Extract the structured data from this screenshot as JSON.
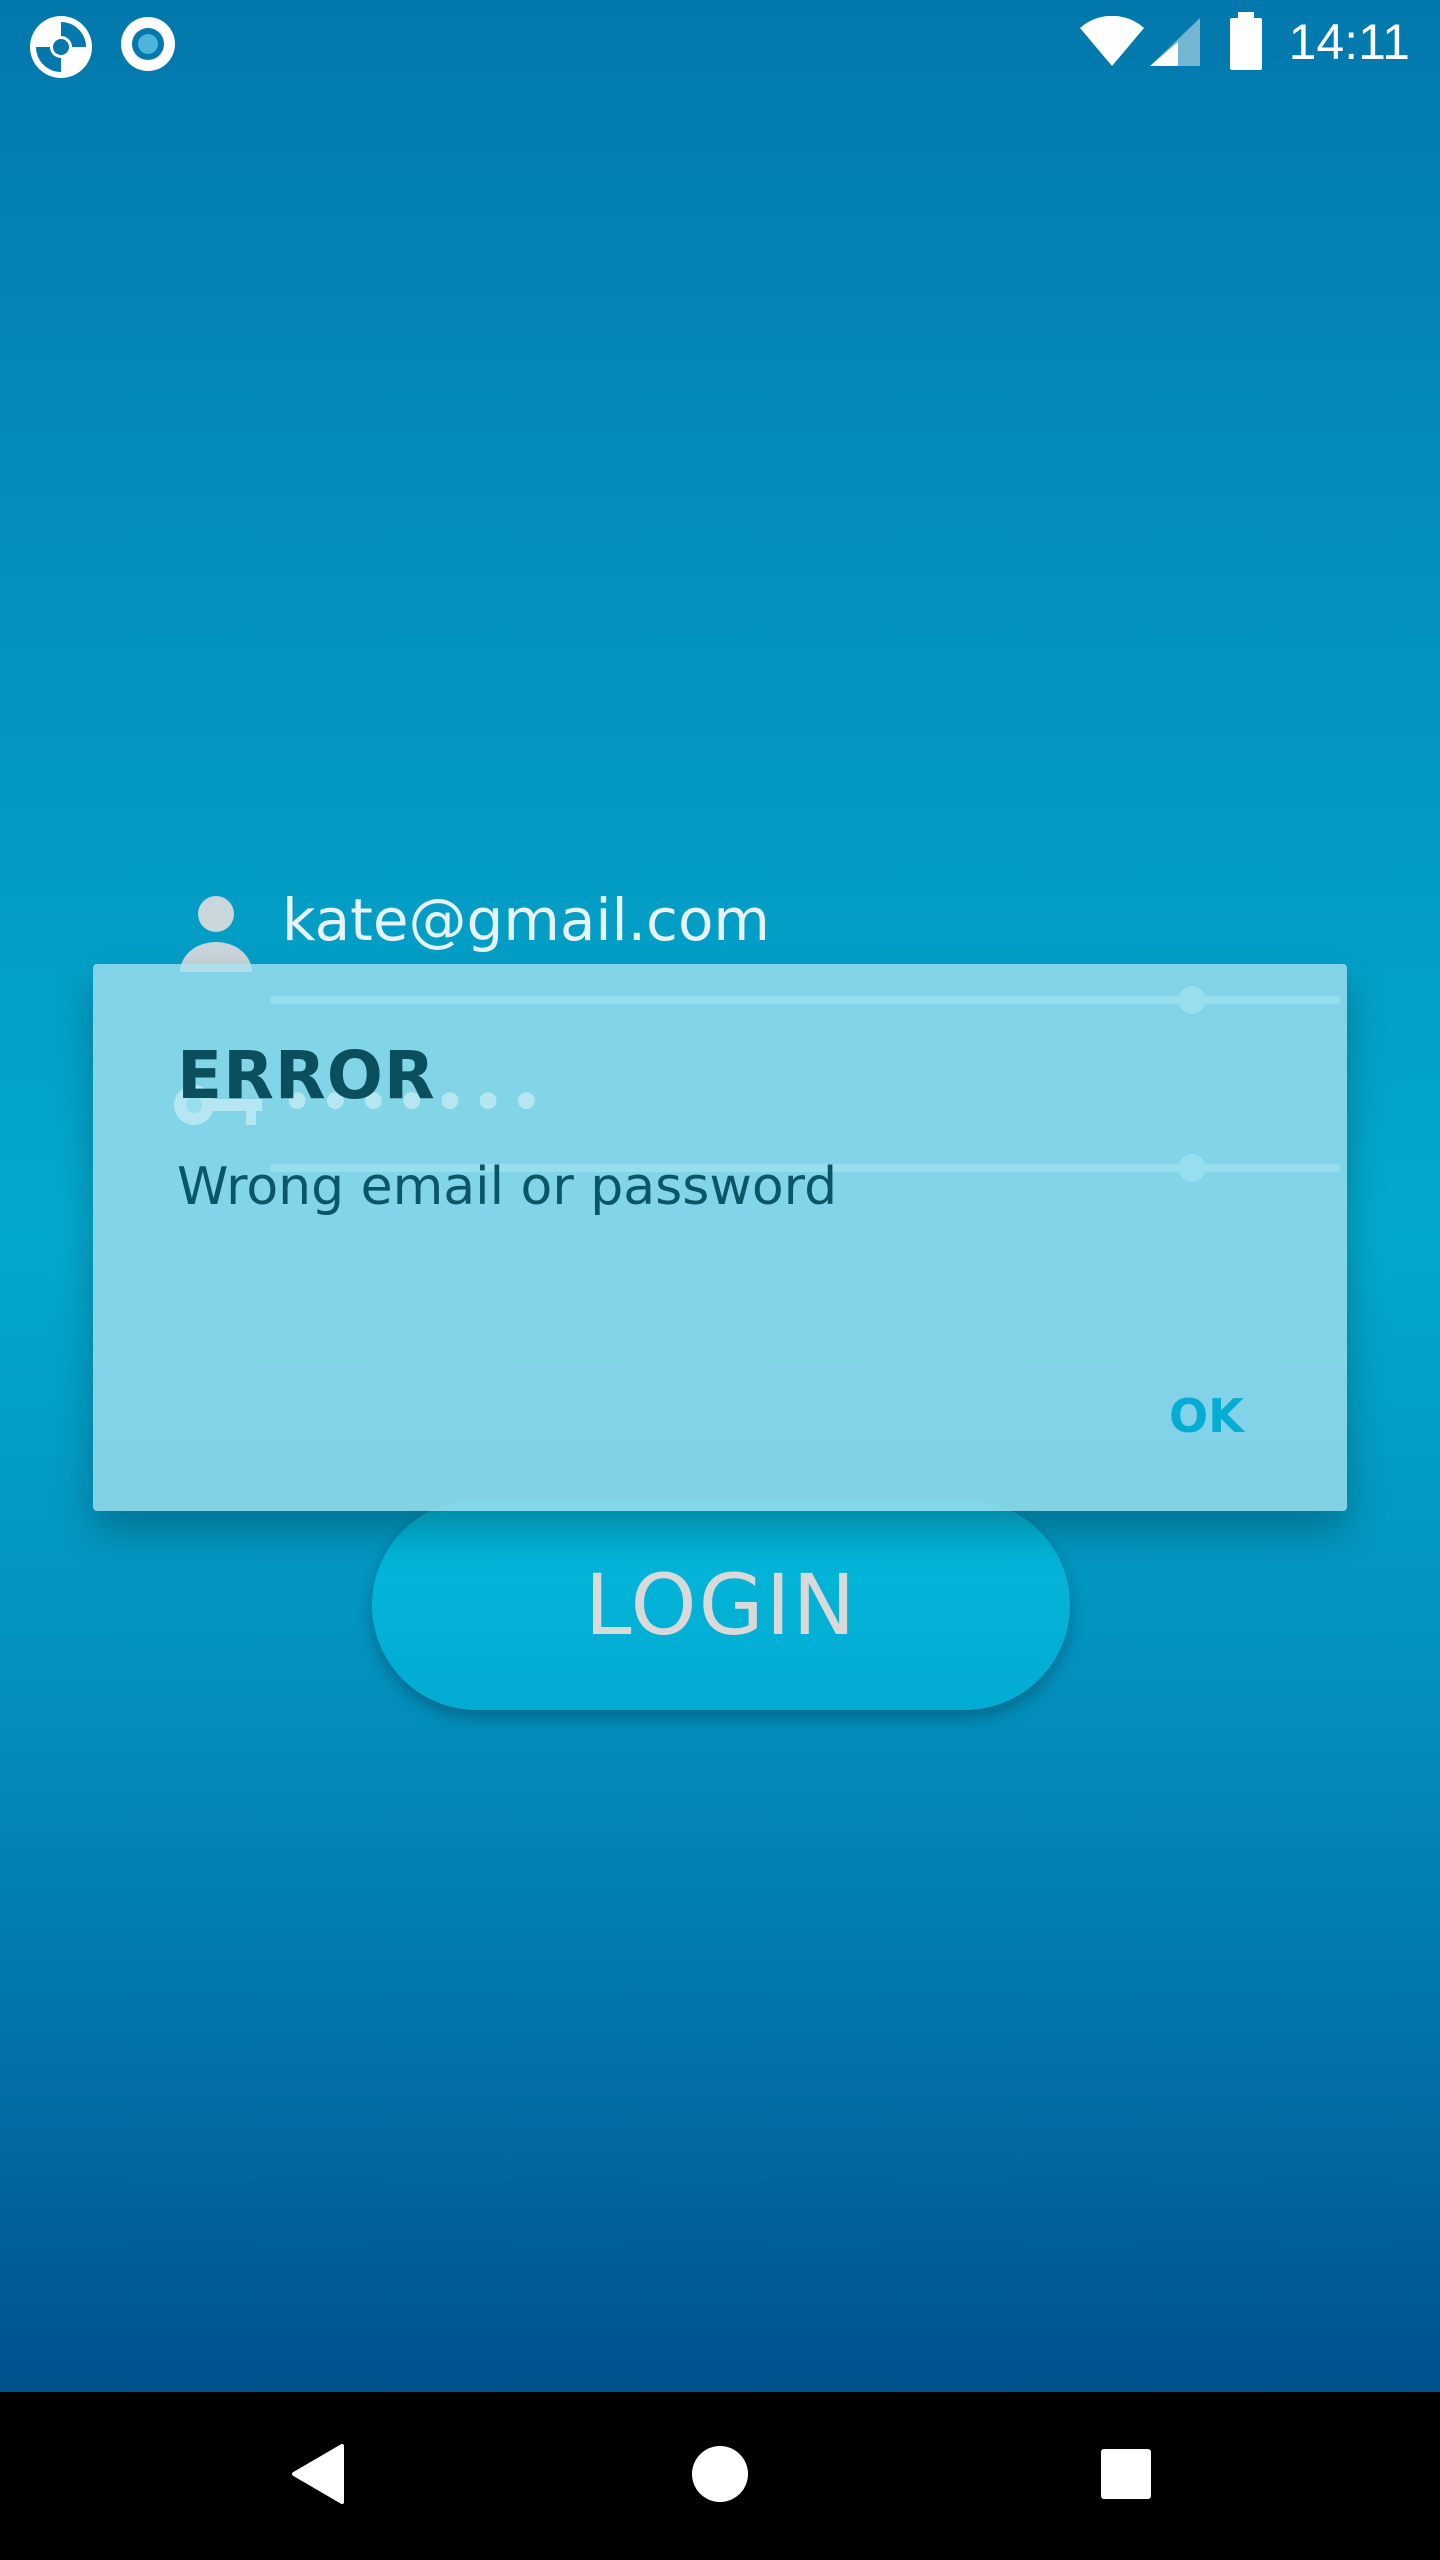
{
  "status_bar": {
    "time": "14:11",
    "left_icons": [
      "app-logo-icon",
      "circle-dot-icon"
    ],
    "right_icons": [
      "wifi-icon",
      "cell-signal-icon",
      "battery-icon"
    ]
  },
  "login_form": {
    "email_value": "kate@gmail.com",
    "password_value": "•••••••",
    "login_label": "LOGIN"
  },
  "dialog": {
    "title": "ERROR",
    "message": "Wrong email or password",
    "ok_label": "OK"
  },
  "nav_bar": {
    "buttons": [
      "back-icon",
      "home-icon",
      "recents-icon"
    ]
  },
  "colors": {
    "accent": "#05acd3",
    "dialog_text": "#0b4f5f",
    "background_top": "#0378ad",
    "background_bottom": "#00427f"
  }
}
